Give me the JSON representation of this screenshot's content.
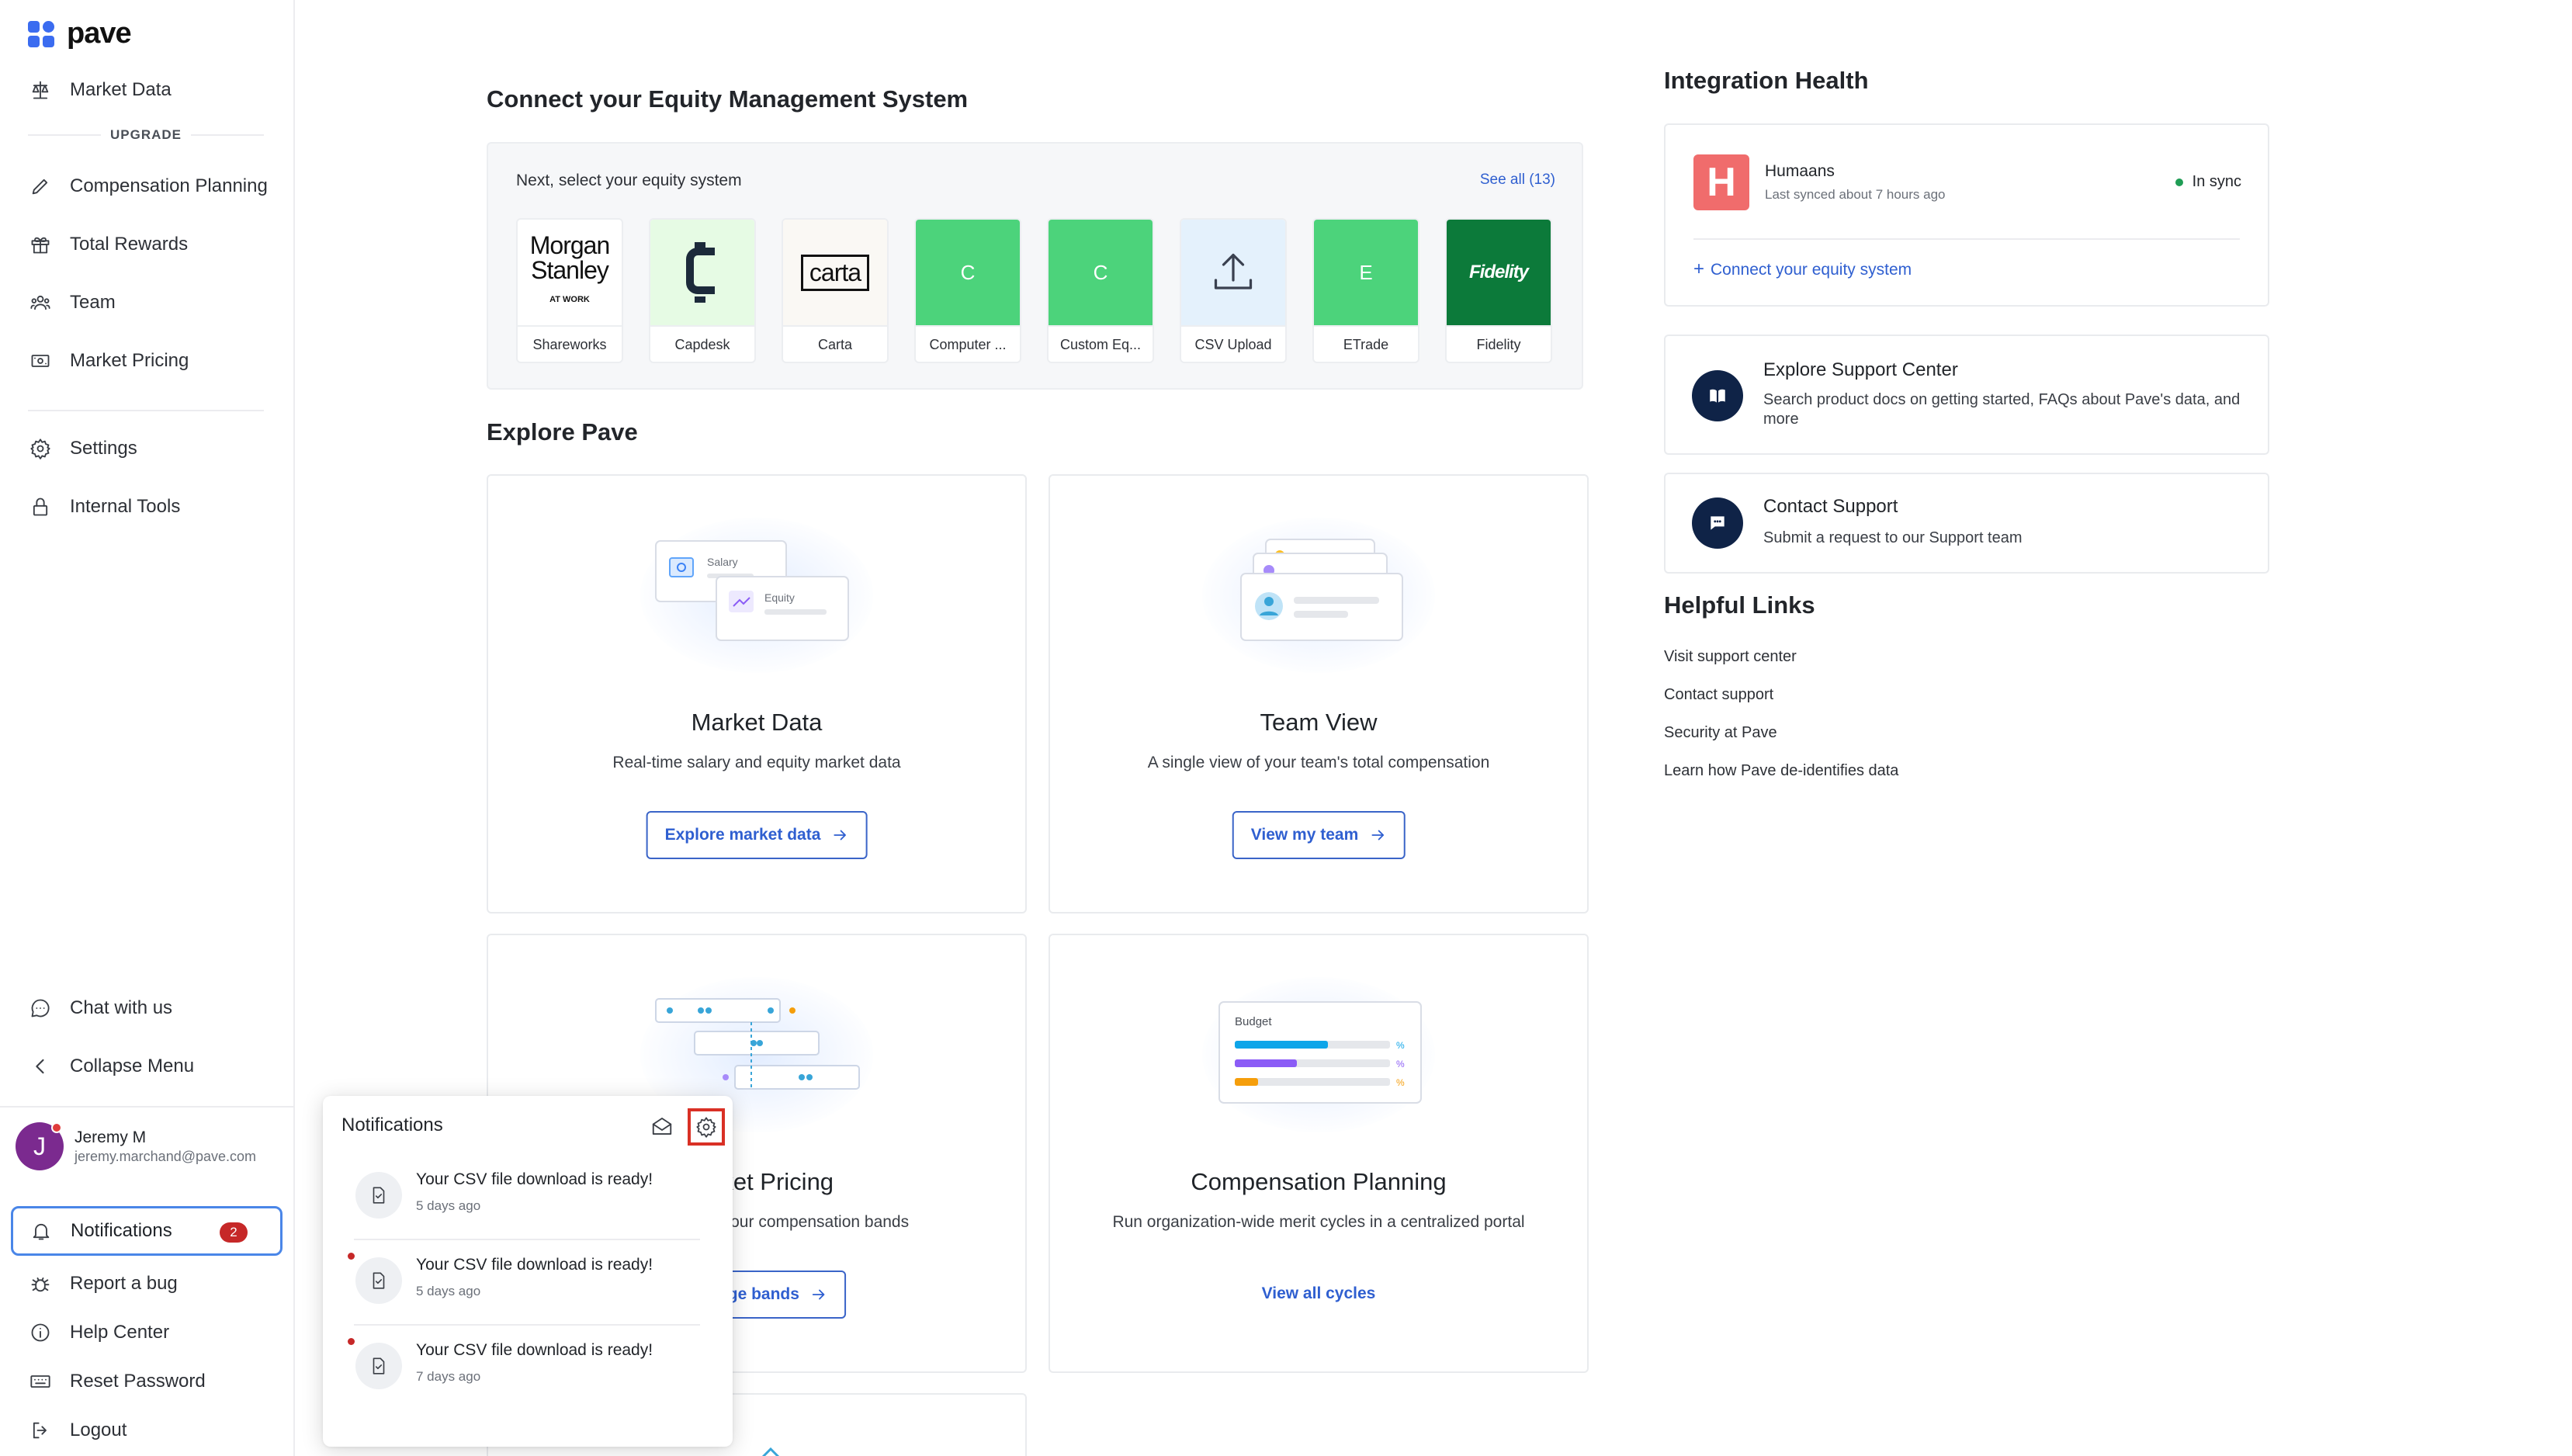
{
  "brand": {
    "name": "pave",
    "color": "#3b6cf0"
  },
  "sidebar": {
    "items": [
      {
        "label": "Market Data",
        "icon": "scale-icon"
      },
      {
        "label": "Compensation Planning",
        "icon": "pencil-icon"
      },
      {
        "label": "Total Rewards",
        "icon": "gift-icon"
      },
      {
        "label": "Team",
        "icon": "team-icon"
      },
      {
        "label": "Market Pricing",
        "icon": "money-icon"
      },
      {
        "label": "Settings",
        "icon": "gear-icon"
      },
      {
        "label": "Internal Tools",
        "icon": "lock-icon"
      }
    ],
    "upgrade_label": "UPGRADE",
    "bottom_items": [
      {
        "label": "Chat with us",
        "icon": "chat-icon"
      },
      {
        "label": "Collapse Menu",
        "icon": "chevron-left-icon"
      }
    ],
    "user": {
      "initial": "J",
      "name": "Jeremy M",
      "email": "jeremy.marchand@pave.com"
    },
    "notifications": {
      "label": "Notifications",
      "count": "2"
    },
    "footer_items": [
      {
        "label": "Report a bug",
        "icon": "bug-icon"
      },
      {
        "label": "Help Center",
        "icon": "info-icon"
      },
      {
        "label": "Reset Password",
        "icon": "keyboard-icon"
      },
      {
        "label": "Logout",
        "icon": "logout-icon"
      }
    ]
  },
  "equity": {
    "title": "Connect your Equity Management System",
    "subtitle": "Next, select your equity system",
    "see_all": "See all (13)",
    "systems": [
      {
        "label": "Shareworks",
        "logo_line1": "Morgan",
        "logo_line2": "Stanley",
        "logo_line3": "AT WORK",
        "bg": "#ffffff"
      },
      {
        "label": "Capdesk",
        "logo": "C",
        "bg": "#e6fbe4"
      },
      {
        "label": "Carta",
        "logo": "carta",
        "bg": "#faf8f4"
      },
      {
        "label": "Computer ...",
        "logo": "C",
        "bg": "#4cd37b"
      },
      {
        "label": "Custom Eq...",
        "logo": "C",
        "bg": "#4cd37b"
      },
      {
        "label": "CSV Upload",
        "logo": "upload-icon",
        "bg": "#e4f1fc"
      },
      {
        "label": "ETrade",
        "logo": "E",
        "bg": "#4cd37b"
      },
      {
        "label": "Fidelity",
        "logo": "Fidelity",
        "bg": "#0c7a3a"
      }
    ]
  },
  "explore": {
    "title": "Explore Pave",
    "cards": [
      {
        "title": "Market Data",
        "desc": "Real-time salary and equity market data",
        "cta": "Explore market data",
        "illus_labels": [
          "Salary",
          "Equity"
        ]
      },
      {
        "title": "Team View",
        "desc": "A single view of your team's total compensation",
        "cta": "View my team"
      },
      {
        "title": "Market Pricing",
        "desc": "Build and share your compensation bands",
        "cta": "Manage bands"
      },
      {
        "title": "Compensation Planning",
        "desc": "Run organization-wide merit cycles in a centralized portal",
        "cta": "View all cycles",
        "illus_label": "Budget"
      }
    ]
  },
  "integration": {
    "title": "Integration Health",
    "provider": "Humaans",
    "last_synced": "Last synced about 7 hours ago",
    "status": "In sync",
    "connect_link": "Connect your equity system"
  },
  "support": [
    {
      "title": "Explore Support Center",
      "desc": "Search product docs on getting started, FAQs about Pave's data, and more",
      "icon": "book-icon"
    },
    {
      "title": "Contact Support",
      "desc": "Submit a request to our Support team",
      "icon": "chat-bubble-icon"
    }
  ],
  "helpful_links": {
    "title": "Helpful Links",
    "links": [
      "Visit support center",
      "Contact support",
      "Security at Pave",
      "Learn how Pave de-identifies data"
    ]
  },
  "popover": {
    "title": "Notifications",
    "items": [
      {
        "text": "Your CSV file download is ready!",
        "time": "5 days ago",
        "unread": false
      },
      {
        "text": "Your CSV file download is ready!",
        "time": "5 days ago",
        "unread": true
      },
      {
        "text": "Your CSV file download is ready!",
        "time": "7 days ago",
        "unread": true
      }
    ]
  }
}
